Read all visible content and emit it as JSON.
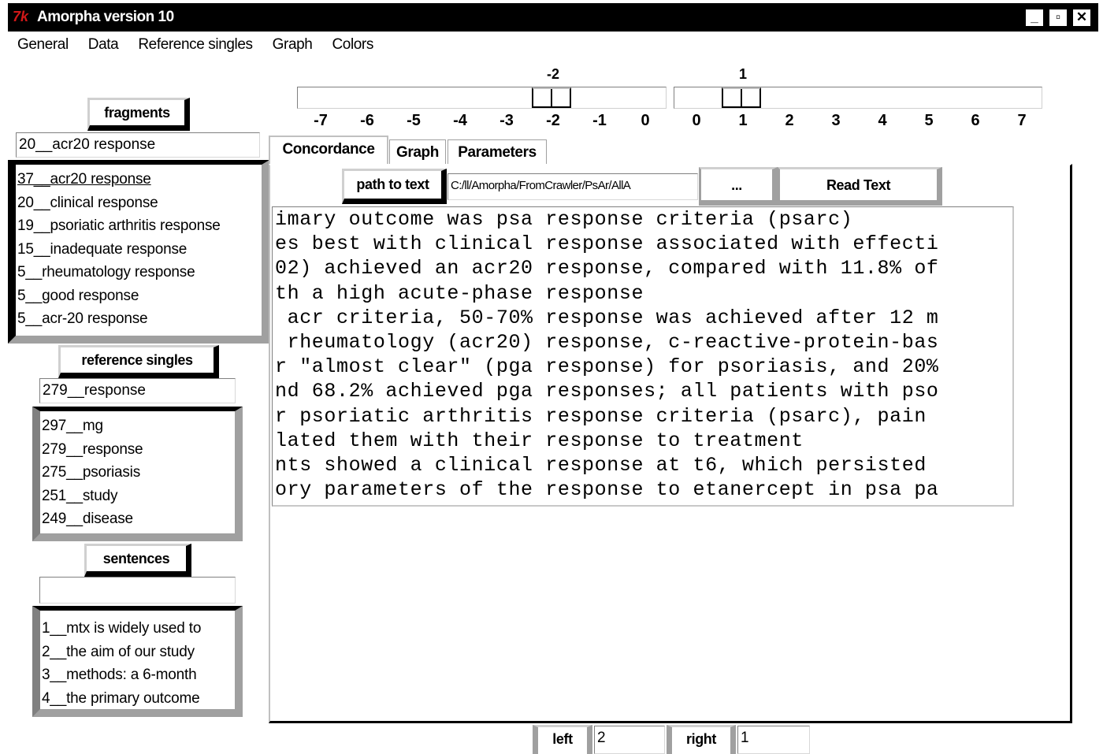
{
  "window": {
    "logo": "7k",
    "title": "Amorpha  version 10",
    "minimize": "_",
    "restore": "▫",
    "close": "✕"
  },
  "menu": [
    "General",
    "Data",
    "Reference singles",
    "Graph",
    "Colors"
  ],
  "sliders": {
    "left": {
      "value": "-2",
      "ticks": [
        "-7",
        "-6",
        "-5",
        "-4",
        "-3",
        "-2",
        "-1",
        "0"
      ]
    },
    "right": {
      "value": "1",
      "ticks": [
        "0",
        "1",
        "2",
        "3",
        "4",
        "5",
        "6",
        "7"
      ]
    }
  },
  "fragments": {
    "label": "fragments",
    "input": "20__acr20 response",
    "items": [
      "37__acr20 response",
      "20__clinical response",
      "19__psoriatic arthritis response",
      "15__inadequate response",
      "5__rheumatology response",
      "5__good response",
      "5__acr-20 response"
    ]
  },
  "reference_singles": {
    "label": "reference singles",
    "input": "279__response",
    "items": [
      "297__mg",
      "279__response",
      "275__psoriasis",
      "251__study",
      "249__disease"
    ]
  },
  "sentences": {
    "label": "sentences",
    "input": "",
    "items": [
      "1__mtx is widely used to",
      "2__the aim of our study",
      "3__methods:  a 6-month",
      "4__the primary outcome"
    ]
  },
  "tabs": [
    "Concordance",
    "Graph",
    "Parameters"
  ],
  "concordance": {
    "path_button": "path to text",
    "path_value": "C:/ll/Amorpha/FromCrawler/PsAr/AllA",
    "browse_button": "...",
    "read_button": "Read Text",
    "lines": [
      "imary outcome was psa response criteria (psarc)",
      "es best with clinical response associated with effecti",
      "02) achieved an acr20 response, compared with 11.8% of",
      "th a high acute-phase response",
      " acr criteria, 50-70% response was achieved after 12 m",
      " rheumatology (acr20) response, c-reactive-protein-bas",
      "r \"almost clear\" (pga response) for psoriasis, and 20%",
      "nd 68.2% achieved pga responses; all patients with pso",
      "r psoriatic arthritis response criteria (psarc), pain",
      "lated them with their response to treatment",
      "nts showed a clinical response at t6, which persisted",
      "ory parameters of the response to etanercept in psa pa"
    ]
  },
  "bottom": {
    "left_label": "left",
    "left_value": "2",
    "right_label": "right",
    "right_value": "1"
  }
}
